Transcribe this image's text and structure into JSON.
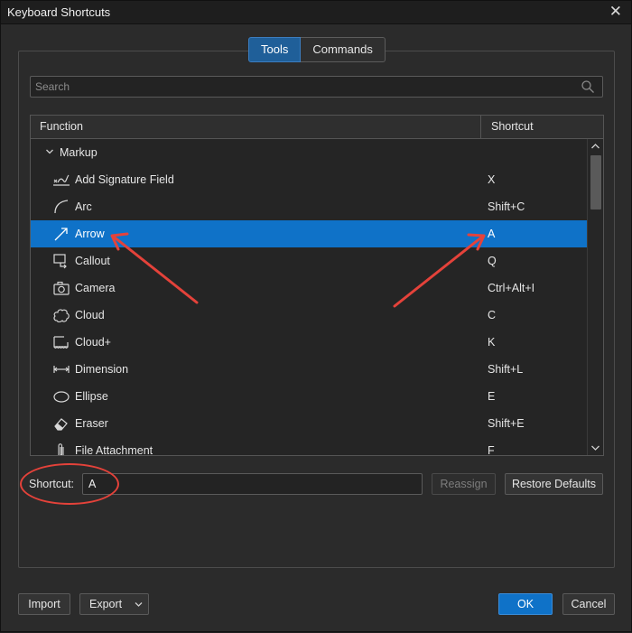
{
  "window": {
    "title": "Keyboard Shortcuts"
  },
  "tabs": [
    {
      "label": "Tools",
      "active": true
    },
    {
      "label": "Commands",
      "active": false
    }
  ],
  "search": {
    "placeholder": "Search",
    "value": ""
  },
  "table": {
    "columns": {
      "function": "Function",
      "shortcut": "Shortcut"
    },
    "group": "Markup",
    "rows": [
      {
        "icon": "signature-field-icon",
        "name": "Add Signature Field",
        "key": "X"
      },
      {
        "icon": "arc-icon",
        "name": "Arc",
        "key": "Shift+C"
      },
      {
        "icon": "arrow-icon",
        "name": "Arrow",
        "key": "A",
        "selected": true
      },
      {
        "icon": "callout-icon",
        "name": "Callout",
        "key": "Q"
      },
      {
        "icon": "camera-icon",
        "name": "Camera",
        "key": "Ctrl+Alt+I"
      },
      {
        "icon": "cloud-icon",
        "name": "Cloud",
        "key": "C"
      },
      {
        "icon": "cloud-plus-icon",
        "name": "Cloud+",
        "key": "K"
      },
      {
        "icon": "dimension-icon",
        "name": "Dimension",
        "key": "Shift+L"
      },
      {
        "icon": "ellipse-icon",
        "name": "Ellipse",
        "key": "E"
      },
      {
        "icon": "eraser-icon",
        "name": "Eraser",
        "key": "Shift+E"
      },
      {
        "icon": "file-attachment-icon",
        "name": "File Attachment",
        "key": "F"
      }
    ]
  },
  "shortcut": {
    "label": "Shortcut:",
    "value": "A"
  },
  "buttons": {
    "reassign": "Reassign",
    "restore_defaults": "Restore Defaults",
    "import": "Import",
    "export": "Export",
    "ok": "OK",
    "cancel": "Cancel"
  },
  "colors": {
    "accent": "#0f72c8",
    "annotation": "#e4423a"
  }
}
